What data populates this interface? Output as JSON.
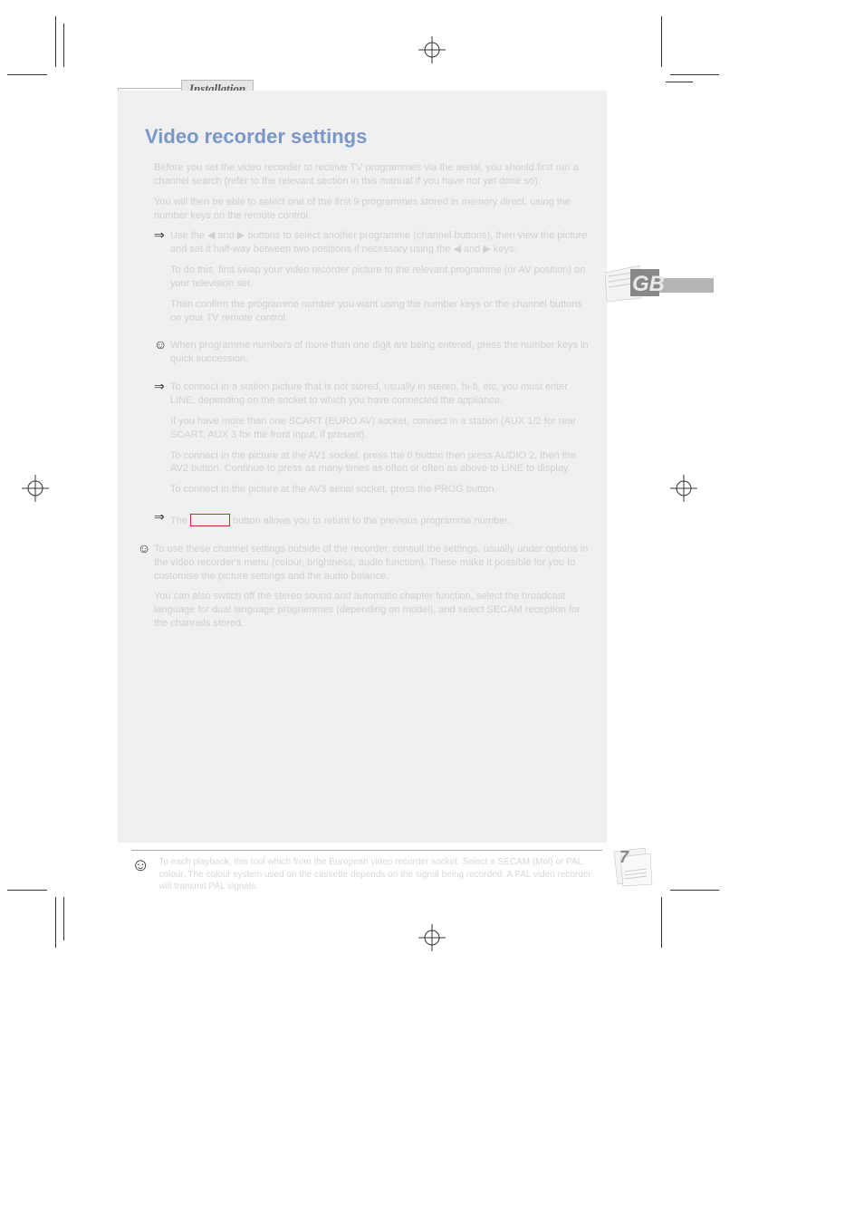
{
  "tab": {
    "label": "Installation"
  },
  "title": "Video recorder settings",
  "intro": [
    "Before you set the video recorder to receive TV programmes via the aerial, you should first run a channel search (refer to the relevant section in this manual if you have not yet done so).",
    "You will then be able to select one of the first 9 programmes stored in memory direct, using the number keys on the remote control."
  ],
  "arrow1": {
    "lead": "Use the ◀ and ▶ buttons to select another programme (channel buttons), then view the picture and set it half-way between two positions if necessary using the ◀ and ▶ keys.",
    "p2": "To do this, first swap your video recorder picture to the relevant programme (or AV position) on your television set.",
    "p3": "Then confirm the programme number you want using the number keys or the channel buttons on your TV remote control."
  },
  "smile1": "When programme numbers of more than one digit are being entered, press the number keys in quick succession.",
  "arrow2": {
    "p1": "To connect in a station picture that is not stored, usually in stereo, hi-fi, etc, you must enter LINE, depending on the socket to which you have connected the appliance.",
    "p2": "If you have more than one SCART (EURO AV) socket, connect in a station (AUX 1/2 for rear SCART, AUX 3 for the front input, if present).",
    "p3": "To connect in the picture at the AV1 socket, press the 0 button then press AUDIO 2, then the AV2 button. Continue to press as many times as often or often as above to LINE to display.",
    "p4": "To connect in the picture at the AV3 aerial socket, press the PROG button."
  },
  "arrow3_prefix": "The ",
  "arrow3_button": " ",
  "arrow3_suffix": " button allows you to return to the previous programme number.",
  "smile2": {
    "p1": "To use these channel settings outside of the recorder, consult the settings, usually under options in the video recorder's menu (colour, brightness, audio function). These make it possible for you to customise the picture settings and the audio balance.",
    "p2": "You can also switch off the stereo sound and automatic chapter function, select the broadcast language for dual language programmes (depending on model), and select SECAM reception for the channels stored."
  },
  "footnote": "To each playback, this tool which from the European video recorder socket. Select a SECAM (Mol) or PAL colour. The colour system used on the cassette depends on the signal being recorded. A PAL video recorder will transmit PAL signals.",
  "gb_label": "GB",
  "page_number": "7",
  "colors": {
    "title": "#7a97c9",
    "red": "#d22"
  }
}
